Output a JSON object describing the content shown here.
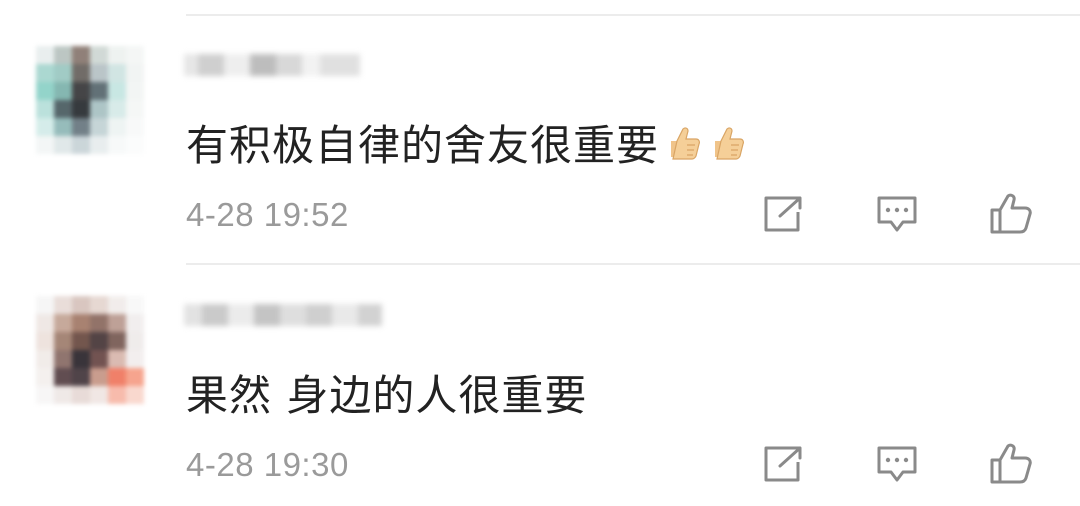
{
  "comments": [
    {
      "text": "有积极自律的舍友很重要",
      "emoji": [
        "thumbs-up",
        "thumbs-up"
      ],
      "time": "4-28 19:52"
    },
    {
      "text": "果然 身边的人很重要",
      "emoji": [],
      "time": "4-28 19:30"
    }
  ],
  "actions": [
    "share-icon",
    "reply-icon",
    "like-icon"
  ],
  "colors": {
    "text": "#222222",
    "meta": "#9a9a9a",
    "icon": "#8a8a8a",
    "divider": "#ececec"
  }
}
